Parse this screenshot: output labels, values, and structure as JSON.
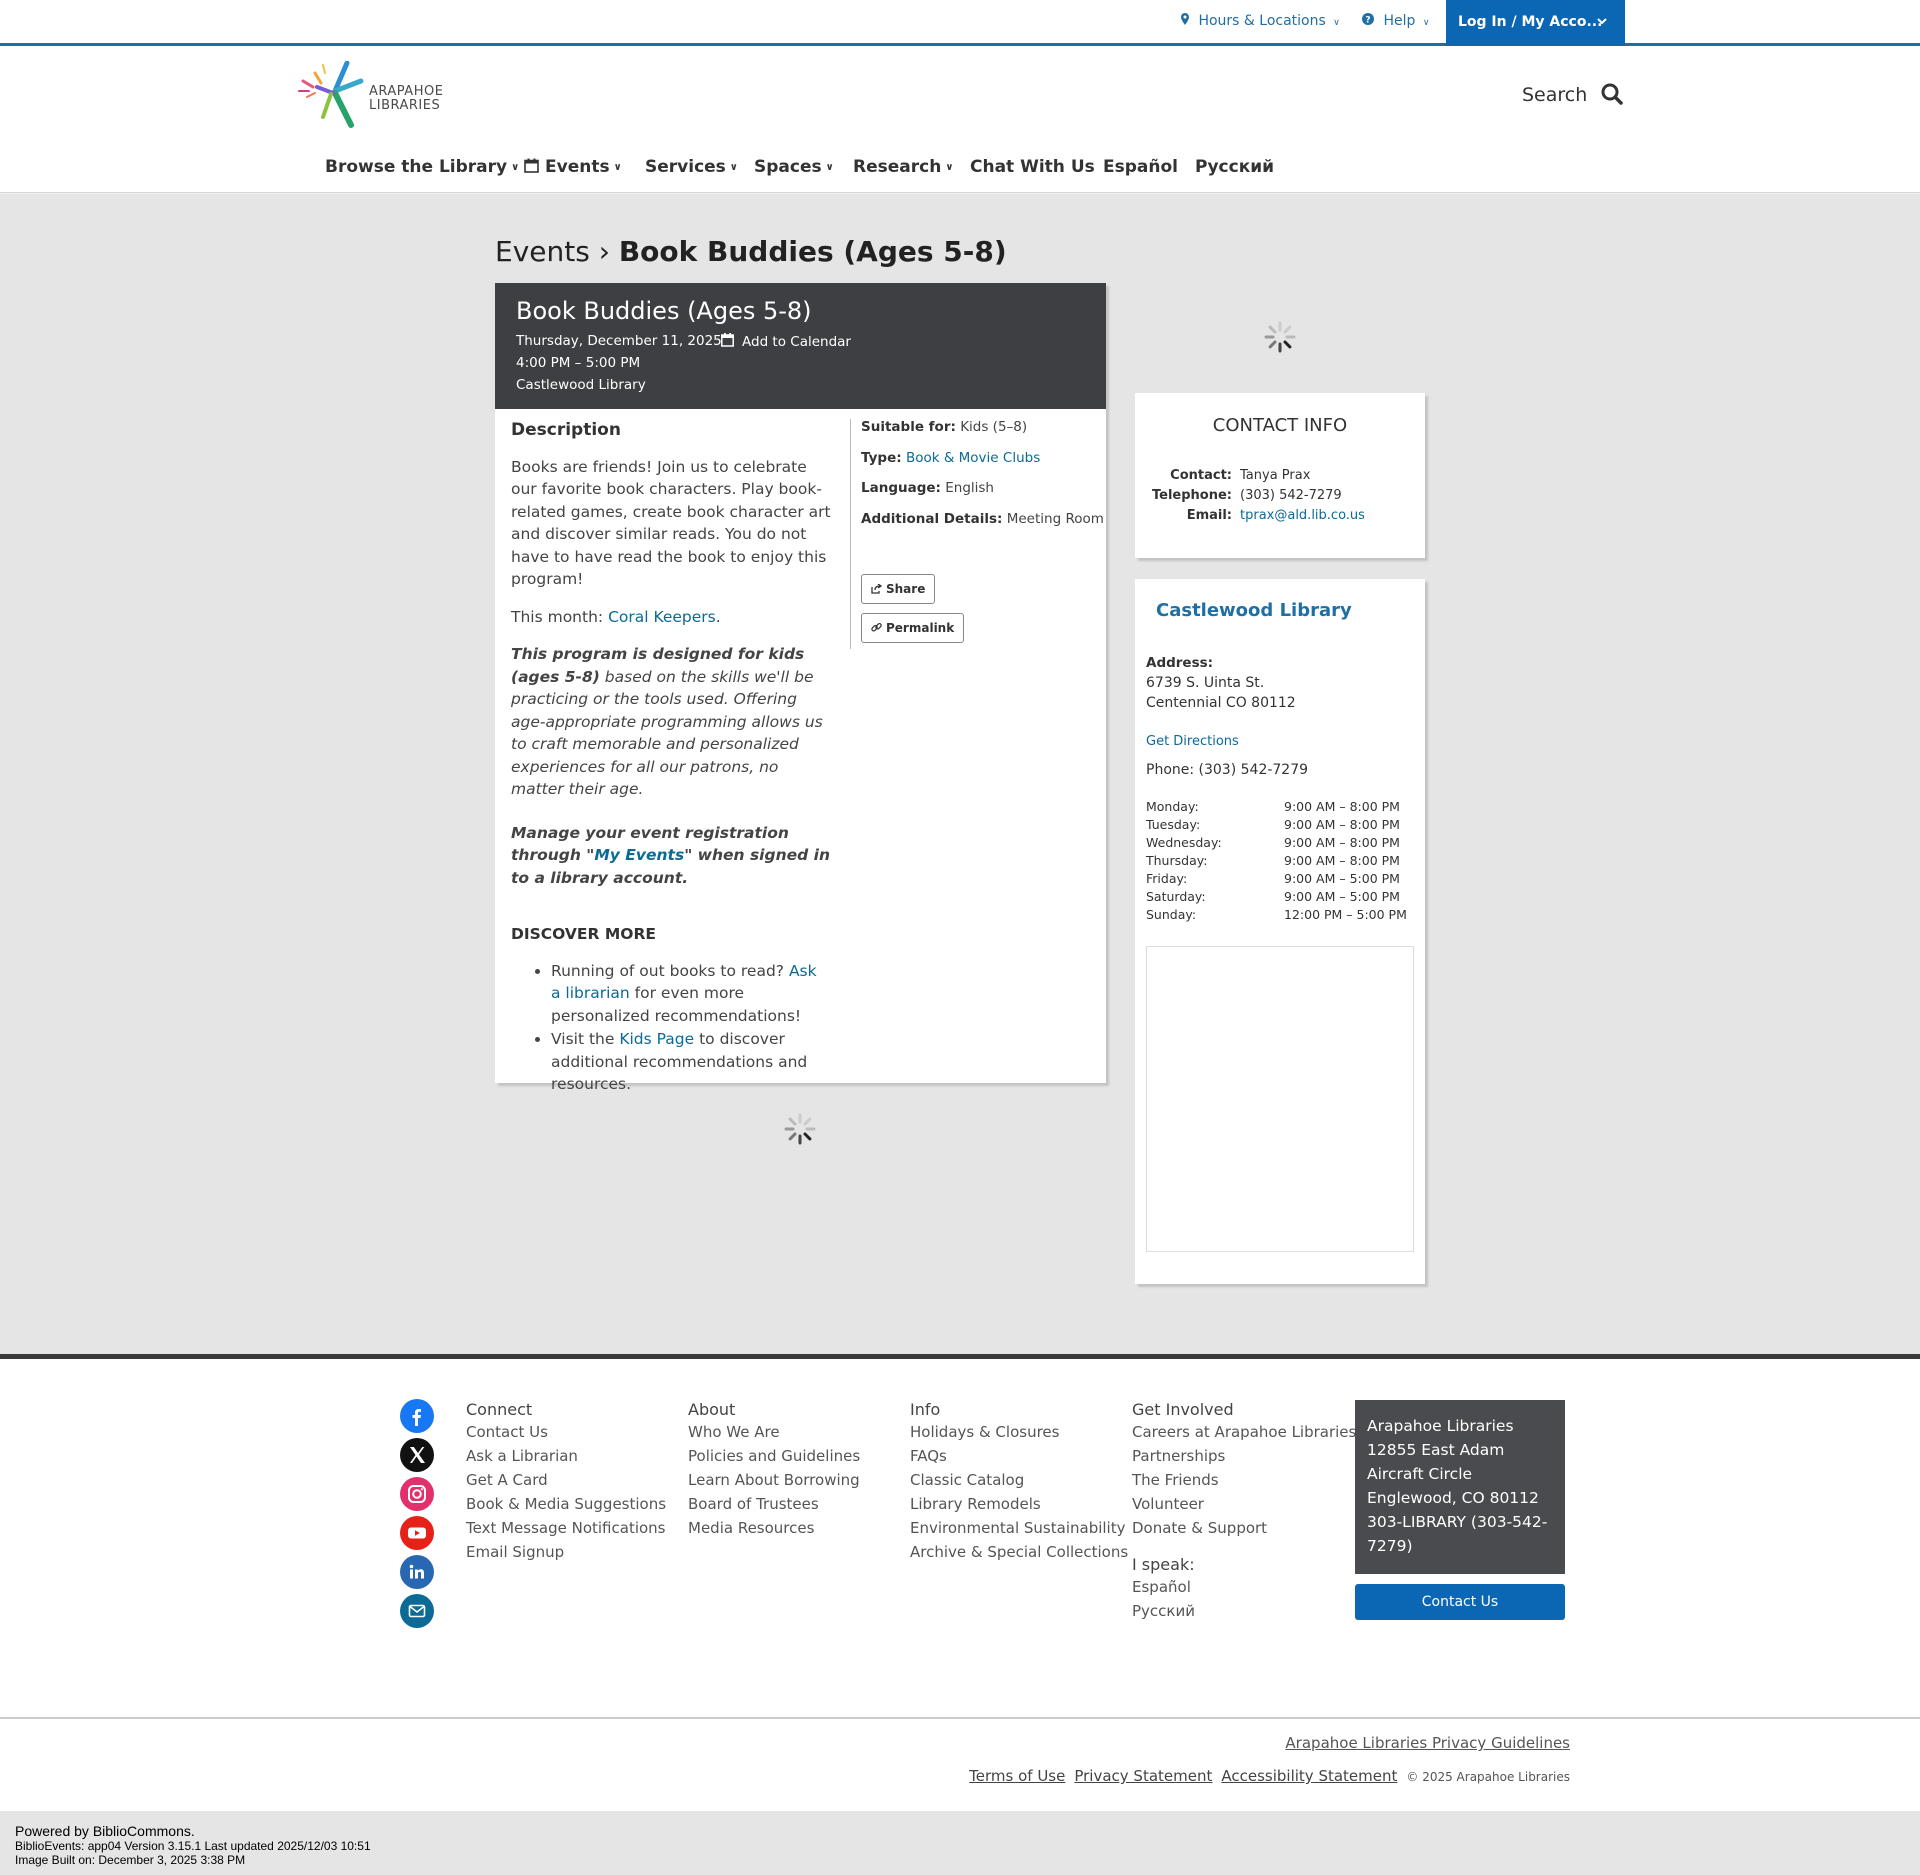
{
  "utility": {
    "hours_locations": "Hours & Locations",
    "help": "Help",
    "login": "Log In / My Acco..."
  },
  "logo": {
    "line1": "ARAPAHOE",
    "line2": "LIBRARIES"
  },
  "search": {
    "label": "Search"
  },
  "nav": [
    {
      "label": "Browse the Library",
      "has_menu": true
    },
    {
      "label": "Events",
      "has_menu": true
    },
    {
      "label": "Services",
      "has_menu": true
    },
    {
      "label": "Spaces",
      "has_menu": true
    },
    {
      "label": "Research",
      "has_menu": true
    },
    {
      "label": "Chat With Us",
      "has_menu": false
    },
    {
      "label": "Español",
      "has_menu": false
    },
    {
      "label": "Русский",
      "has_menu": false
    }
  ],
  "breadcrumb": {
    "parent": "Events",
    "separator": "›",
    "current": "Book Buddies (Ages 5-8)"
  },
  "event": {
    "title": "Book Buddies (Ages 5-8)",
    "date": "Thursday, December 11, 2025",
    "add_to_calendar": "Add to Calendar",
    "time": "4:00 PM – 5:00 PM",
    "location": "Castlewood Library",
    "description_heading": "Description",
    "description": "Books are friends! Join us to celebrate our favorite book characters. Play book-related games, create book character art and discover similar reads. You do not have to have read the book to enjoy this program!",
    "this_month_prefix": "This month: ",
    "this_month_link": "Coral Keepers",
    "this_month_suffix": ".",
    "age_note_bold": "This program is designed for kids (ages 5-8)",
    "age_note_rest": " based on the skills we'll be practicing or the tools used. Offering age-appropriate programming allows us to craft memorable and personalized experiences for all our patrons, no matter their age.",
    "manage_prefix": "Manage your event registration through \"",
    "manage_link": "My Events",
    "manage_suffix": "\" when signed in to a library account.",
    "discover_heading": "DISCOVER MORE",
    "discover_1_prefix": "Running of out books to read? ",
    "discover_1_link": "Ask a librarian",
    "discover_1_suffix": " for even more personalized recommendations!",
    "discover_2_prefix": "Visit the ",
    "discover_2_link": "Kids Page",
    "discover_2_suffix": " to discover additional recommendations and resources.",
    "meta": {
      "suitable_label": "Suitable for:",
      "suitable": "Kids (5–8)",
      "type_label": "Type:",
      "type": "Book & Movie Clubs",
      "language_label": "Language:",
      "language": "English",
      "details_label": "Additional Details:",
      "details": "Meeting Room"
    },
    "share": "Share",
    "permalink": "Permalink"
  },
  "contact": {
    "heading": "CONTACT INFO",
    "contact_label": "Contact:",
    "contact": "Tanya Prax",
    "telephone_label": "Telephone:",
    "telephone": "(303) 542-7279",
    "email_label": "Email:",
    "email": "tprax@ald.lib.co.us"
  },
  "library": {
    "name": "Castlewood Library",
    "address_label": "Address:",
    "address_line1": "6739 S. Uinta St.",
    "address_line2": "Centennial CO 80112",
    "directions": "Get Directions",
    "phone": "Phone: (303) 542-7279",
    "hours": [
      {
        "day": "Monday:",
        "hours": "9:00 AM – 8:00 PM"
      },
      {
        "day": "Tuesday:",
        "hours": "9:00 AM – 8:00 PM"
      },
      {
        "day": "Wednesday:",
        "hours": "9:00 AM – 8:00 PM"
      },
      {
        "day": "Thursday:",
        "hours": "9:00 AM – 8:00 PM"
      },
      {
        "day": "Friday:",
        "hours": "9:00 AM – 5:00 PM"
      },
      {
        "day": "Saturday:",
        "hours": "9:00 AM – 5:00 PM"
      },
      {
        "day": "Sunday:",
        "hours": "12:00 PM – 5:00 PM"
      }
    ]
  },
  "footer": {
    "social": [
      {
        "icon": "facebook-icon",
        "color": "#1877f2"
      },
      {
        "icon": "x-icon",
        "color": "#111111"
      },
      {
        "icon": "instagram-icon",
        "color": "#e1306c"
      },
      {
        "icon": "youtube-icon",
        "color": "#e62117"
      },
      {
        "icon": "linkedin-icon",
        "color": "#2867b2"
      },
      {
        "icon": "email-icon",
        "color": "#0b6a96"
      }
    ],
    "connect": {
      "heading": "Connect",
      "links": [
        "Contact Us",
        "Ask a Librarian",
        "Get A Card",
        "Book & Media Suggestions",
        "Text Message Notifications",
        "Email Signup"
      ]
    },
    "about": {
      "heading": "About",
      "links": [
        "Who We Are",
        "Policies and Guidelines",
        "Learn About Borrowing",
        "Board of Trustees",
        "Media Resources"
      ]
    },
    "info": {
      "heading": "Info",
      "links": [
        "Holidays & Closures",
        "FAQs",
        "Classic Catalog",
        "Library Remodels",
        "Environmental Sustainability",
        "Archive & Special Collections"
      ]
    },
    "involved": {
      "heading": "Get Involved",
      "links": [
        "Careers at Arapahoe Libraries",
        "Partnerships",
        "The Friends",
        "Volunteer",
        "Donate & Support"
      ],
      "speak_heading": "I speak:",
      "languages": [
        "Español",
        "Русский"
      ]
    },
    "address": [
      "Arapahoe Libraries",
      "12855 East Adam",
      "Aircraft Circle",
      "Englewood, CO 80112",
      "303-LIBRARY (303-542-",
      "7279)"
    ],
    "contact_button": "Contact Us",
    "privacy_guidelines": "Arapahoe Libraries Privacy Guidelines",
    "terms": "Terms of Use",
    "privacy": "Privacy Statement",
    "accessibility": "Accessibility Statement",
    "copyright": "© 2025 Arapahoe Libraries"
  },
  "powered": {
    "line1": "Powered by BiblioCommons.",
    "line2": "BiblioEvents: app04 Version 3.15.1 Last updated 2025/12/03 10:51",
    "line3": "Image Built on: December 3, 2025 3:38 PM"
  }
}
